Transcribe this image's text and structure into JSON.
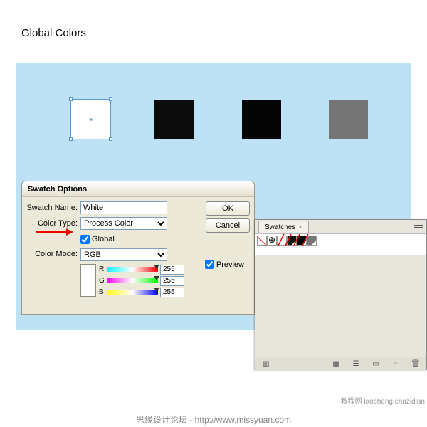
{
  "page": {
    "title": "Global Colors",
    "footer": "思缘设计论坛 - http://www.missyuan.com",
    "watermark": "教程网 laocheng.chazidian"
  },
  "squares": {
    "colors": [
      "#ffffff",
      "#0c0c0c",
      "#050505",
      "#757575"
    ]
  },
  "dialog": {
    "title": "Swatch Options",
    "swatch_name_label": "Swatch Name:",
    "swatch_name_value": "White",
    "color_type_label": "Color Type:",
    "color_type_value": "Process Color",
    "global_label": "Global",
    "global_checked": true,
    "color_mode_label": "Color Mode:",
    "color_mode_value": "RGB",
    "r_label": "R",
    "g_label": "G",
    "b_label": "B",
    "r_val": "255",
    "g_val": "255",
    "b_val": "255",
    "ok_label": "OK",
    "cancel_label": "Cancel",
    "preview_label": "Preview",
    "preview_checked": true,
    "swatch_preview_color": "#ffffff"
  },
  "panel": {
    "tab": "Swatches",
    "swatches": [
      "none",
      "registration",
      "white",
      "black",
      "black2",
      "gray"
    ]
  }
}
